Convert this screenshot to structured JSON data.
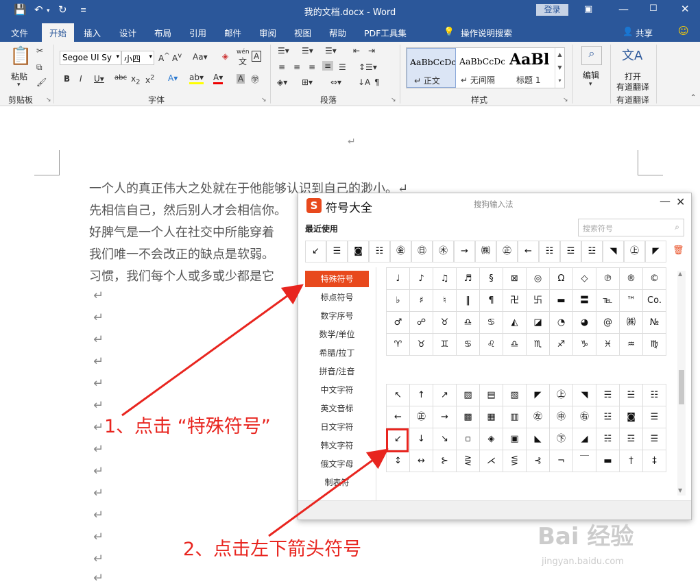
{
  "window": {
    "title": "我的文档.docx  -  Word",
    "login": "登录"
  },
  "tabs": [
    "文件",
    "开始",
    "插入",
    "设计",
    "布局",
    "引用",
    "邮件",
    "审阅",
    "视图",
    "帮助",
    "PDF工具集"
  ],
  "active_tab": "开始",
  "tell_me": "操作说明搜索",
  "share": "共享",
  "ribbon": {
    "clipboard": {
      "paste": "粘贴",
      "label": "剪贴板"
    },
    "font": {
      "font_name": "Segoe UI Sy",
      "font_size": "小四",
      "label": "字体",
      "phonetic": "wén"
    },
    "paragraph": {
      "label": "段落"
    },
    "styles": {
      "label": "样式",
      "items": [
        {
          "preview": "AaBbCcDc",
          "name": "正文"
        },
        {
          "preview": "AaBbCcDc",
          "name": "无间隔"
        },
        {
          "preview": "AaBl",
          "name": "标题 1"
        }
      ]
    },
    "editing": {
      "label": "编辑"
    },
    "translate": {
      "line1": "打开",
      "line2": "有道翻译",
      "label": "有道翻译"
    }
  },
  "document": {
    "paragraphs": [
      "一个人的真正伟大之处就在于他能够认识到自己的渺小。↵",
      "先相信自己，然后别人才会相信你。",
      "好脾气是一个人在社交中所能穿着",
      "我们唯一不会改正的缺点是软弱。",
      "习惯，我们每个人或多或少都是它"
    ],
    "return_mark": "↵"
  },
  "dialog": {
    "title": "符号大全",
    "subtitle": "搜狗输入法",
    "recent_label": "最近使用",
    "search_placeholder": "搜索符号",
    "recent_symbols": [
      "↙",
      "☰",
      "◙",
      "☷",
      "㊎",
      "㊐",
      "㊍",
      "→",
      "㈱",
      "㊣",
      "←",
      "☷",
      "☲",
      "☳",
      "◥",
      "㊤",
      "◤"
    ],
    "categories": [
      "特殊符号",
      "标点符号",
      "数字序号",
      "数学/单位",
      "希腊/拉丁",
      "拼音/注音",
      "中文字符",
      "英文音标",
      "日文字符",
      "韩文字符",
      "俄文字母",
      "制表符"
    ],
    "active_category": "特殊符号",
    "grid1": [
      [
        "♩",
        "♪",
        "♫",
        "♬",
        "§",
        "⊠",
        "◎",
        "Ω",
        "◇",
        "℗",
        "®",
        "©"
      ],
      [
        "♭",
        "♯",
        "♮",
        "‖",
        "¶",
        "卍",
        "卐",
        "▬",
        "〓",
        "℡",
        "™",
        "Co."
      ],
      [
        "♂",
        "☍",
        "♉",
        "♎",
        "♋",
        "◭",
        "◪",
        "◔",
        "◕",
        "@",
        "㈱",
        "№"
      ],
      [
        "♈",
        "♉",
        "♊",
        "♋",
        "♌",
        "♎",
        "♏",
        "♐",
        "♑",
        "♓",
        "♒",
        "♍"
      ]
    ],
    "grid2": [
      [
        "↖",
        "↑",
        "↗",
        "▨",
        "▤",
        "▧",
        "◤",
        "㊤",
        "◥",
        "☴",
        "☱",
        "☷"
      ],
      [
        "←",
        "㊣",
        "→",
        "▩",
        "▦",
        "▥",
        "㊧",
        "㊥",
        "㊨",
        "☳",
        "◙",
        "☰"
      ],
      [
        "↙",
        "↓",
        "↘",
        "▫",
        "◈",
        "▣",
        "◣",
        "㊦",
        "◢",
        "☵",
        "☲",
        "☰"
      ],
      [
        "↕",
        "↔",
        "⊱",
        "⋛",
        "⋌",
        "⋚",
        "⊰",
        "¬",
        "￣",
        "▬",
        "†",
        "‡"
      ]
    ]
  },
  "annotations": {
    "step1": "1、点击 “特殊符号”",
    "step2": "2、点击左下箭头符号"
  },
  "watermark": {
    "main": "Bai 经验",
    "sub": "jingyan.baidu.com"
  },
  "colors": {
    "word_blue": "#2b579a",
    "sogou_orange": "#e8491d",
    "annotation_red": "#e8251f"
  }
}
